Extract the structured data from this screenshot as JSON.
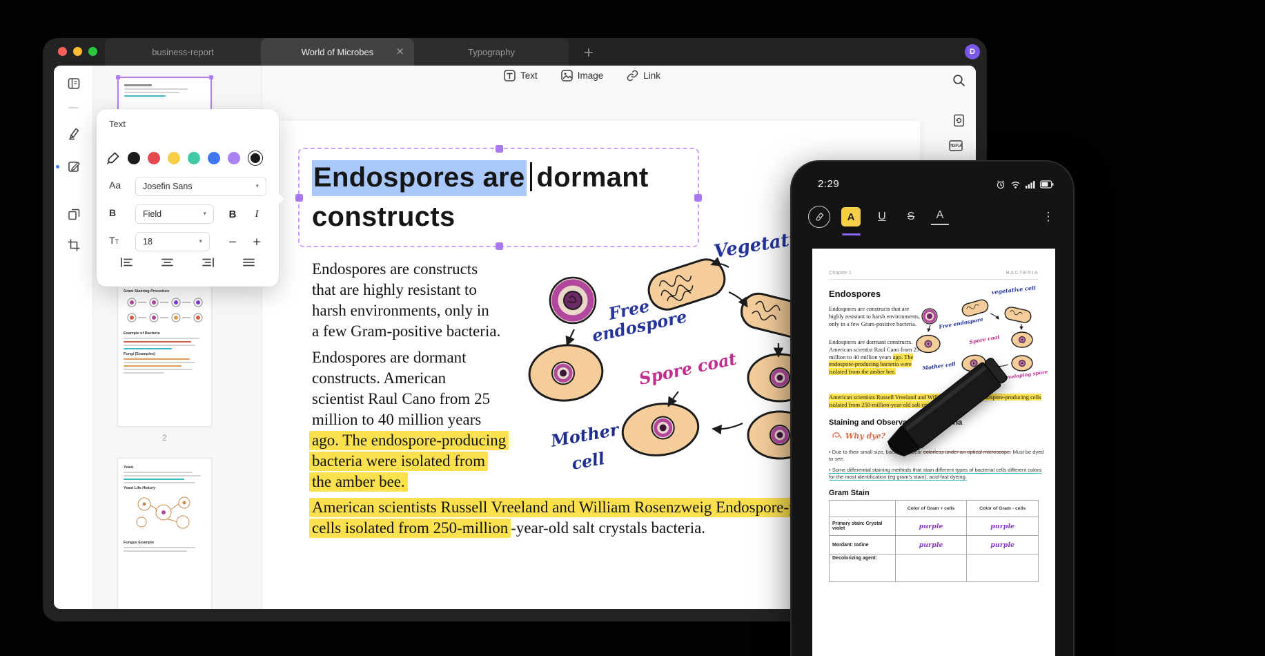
{
  "window": {
    "tabs": [
      {
        "label": "business-report"
      },
      {
        "label": "World of Microbes"
      },
      {
        "label": "Typography"
      }
    ],
    "avatar_initial": "D"
  },
  "icons": {
    "close": "×",
    "new_tab": "+",
    "menu_dots": "⋮",
    "chevron_down": "▾",
    "minus": "−",
    "plus": "+"
  },
  "colors": {
    "accent_purple": "#8a63f0",
    "highlight_yellow": "#fbe14e",
    "selection_blue": "#a9c8fb",
    "selection_handle_purple": "#a978ee",
    "avatar_bg": "#7a58e8"
  },
  "toolbar": {
    "text_label": "Text",
    "image_label": "Image",
    "link_label": "Link"
  },
  "right_rail": {
    "pdfa_label": "PDF/A"
  },
  "text_panel": {
    "title": "Text",
    "font_row_label": "Aa",
    "font_name": "Josefin Sans",
    "style_row_label": "B",
    "style_value": "Field",
    "bold_label": "B",
    "italic_label": "I",
    "size_row_label_main": "T",
    "size_row_label_sub": "T",
    "size_value": "18",
    "colors": [
      "#1b1b1b",
      "#e5484d",
      "#f7ce46",
      "#41c9a6",
      "#3f78f2",
      "#a883f0"
    ],
    "selected_color": "#1b1b1b"
  },
  "thumbnails": {
    "page2_label": "2",
    "thumb2": {
      "title1": "Gram Staining Procedure",
      "title2": "Example of Bacteria",
      "title3": "Fungi  (Examples)"
    },
    "thumb3": {
      "title1": "Yeast",
      "title2": "Yeast Life History",
      "title3": "Fungus Example"
    }
  },
  "document": {
    "title_selected": "Endospores are",
    "title_after": "dormant",
    "title_line2": "constructs",
    "para1_lines": [
      "Endospores are constructs",
      "that are highly resistant to",
      "harsh environments, only in",
      "a few Gram-positive bacteria."
    ],
    "para2_lines": [
      "Endospores are dormant",
      "constructs. American",
      "scientist Raul Cano from 25",
      "million to 40 million years"
    ],
    "para2_highlight_lines": [
      "ago. The endospore-producing",
      "bacteria were isolated from",
      "the amber bee."
    ],
    "para3_line1": "American scientists Russell Vreeland and William Rosenzweig Endospore-producing",
    "para3_line2_highlight": "cells isolated from 250-million",
    "para3_line2_rest": "-year-old salt crystals bacteria.",
    "illustration_labels": {
      "vegetative": "Vegetative",
      "free_line1": "Free",
      "free_line2": "endospore",
      "spore_coat": "Spore coat",
      "mother_line1": "Mother",
      "mother_line2": "cell"
    }
  },
  "phone": {
    "status_time": "2:29",
    "tools": {
      "highlight": "A",
      "underline": "U",
      "strike": "S",
      "color": "A"
    },
    "doc": {
      "chapter": "Chapter 1",
      "section": "BACTERIA",
      "heading1": "Endospores",
      "para1": "Endospores are constructs that are highly resistant to harsh environments, only in a few Gram-positive bacteria.",
      "para2_normal": "Endospores are dormant constructs. American scientist Raul Cano from 25 million to 40 million years ",
      "para2_highlight": "ago. The endospore-producing bacteria were isolated from the amber bee.",
      "para3_highlight": "American scientists Russell Vreeland and William Rosenzweig Endospore-producing cells isolated from 250-million-year-old salt crystals bacteria.",
      "heading2": "Staining and Observation of Bacteria",
      "why_dye": "Why dye?",
      "bullet1_pre": "•  Due to their small size, bacteria appear ",
      "bullet1_strike": "colorless under an optical microscope.",
      "bullet1_post": " Must be dyed to see.",
      "bullet2": "•  Some differential staining methods that stain different types of bacterial cells different colors for the most identification (eg gram's stain), acid-fast dyeing.",
      "heading3": "Gram Stain",
      "table": {
        "headers": [
          "",
          "Color of Gram + cells",
          "Color of Gram - cells"
        ],
        "rows": [
          {
            "label": "Primary stain: Crystal violet",
            "plus": "purple",
            "minus": "purple"
          },
          {
            "label": "Mordant: Iodine",
            "plus": "purple",
            "minus": "purple"
          },
          {
            "label": "Decolorizing agent:",
            "plus": "",
            "minus": ""
          }
        ]
      },
      "mini_labels": {
        "vegetative": "vegetative cell",
        "free": "Free endospore",
        "spore": "Spore coat",
        "mother": "Mother cell",
        "developing": "Developing spore coat"
      }
    }
  }
}
